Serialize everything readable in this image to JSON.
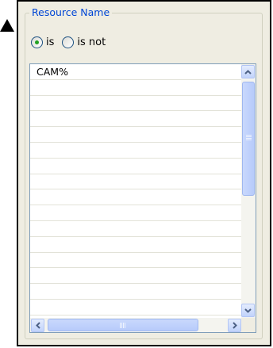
{
  "filter": {
    "title": "Resource Name",
    "options": [
      {
        "label": "is",
        "selected": true
      },
      {
        "label": "is not",
        "selected": false
      }
    ]
  },
  "list": {
    "items": [
      "CAM%",
      "",
      "",
      "",
      "",
      "",
      "",
      "",
      "",
      "",
      "",
      "",
      "",
      "",
      "",
      ""
    ]
  },
  "colors": {
    "legend": "#0046d5",
    "accent": "#21a121",
    "background": "#efede2"
  }
}
